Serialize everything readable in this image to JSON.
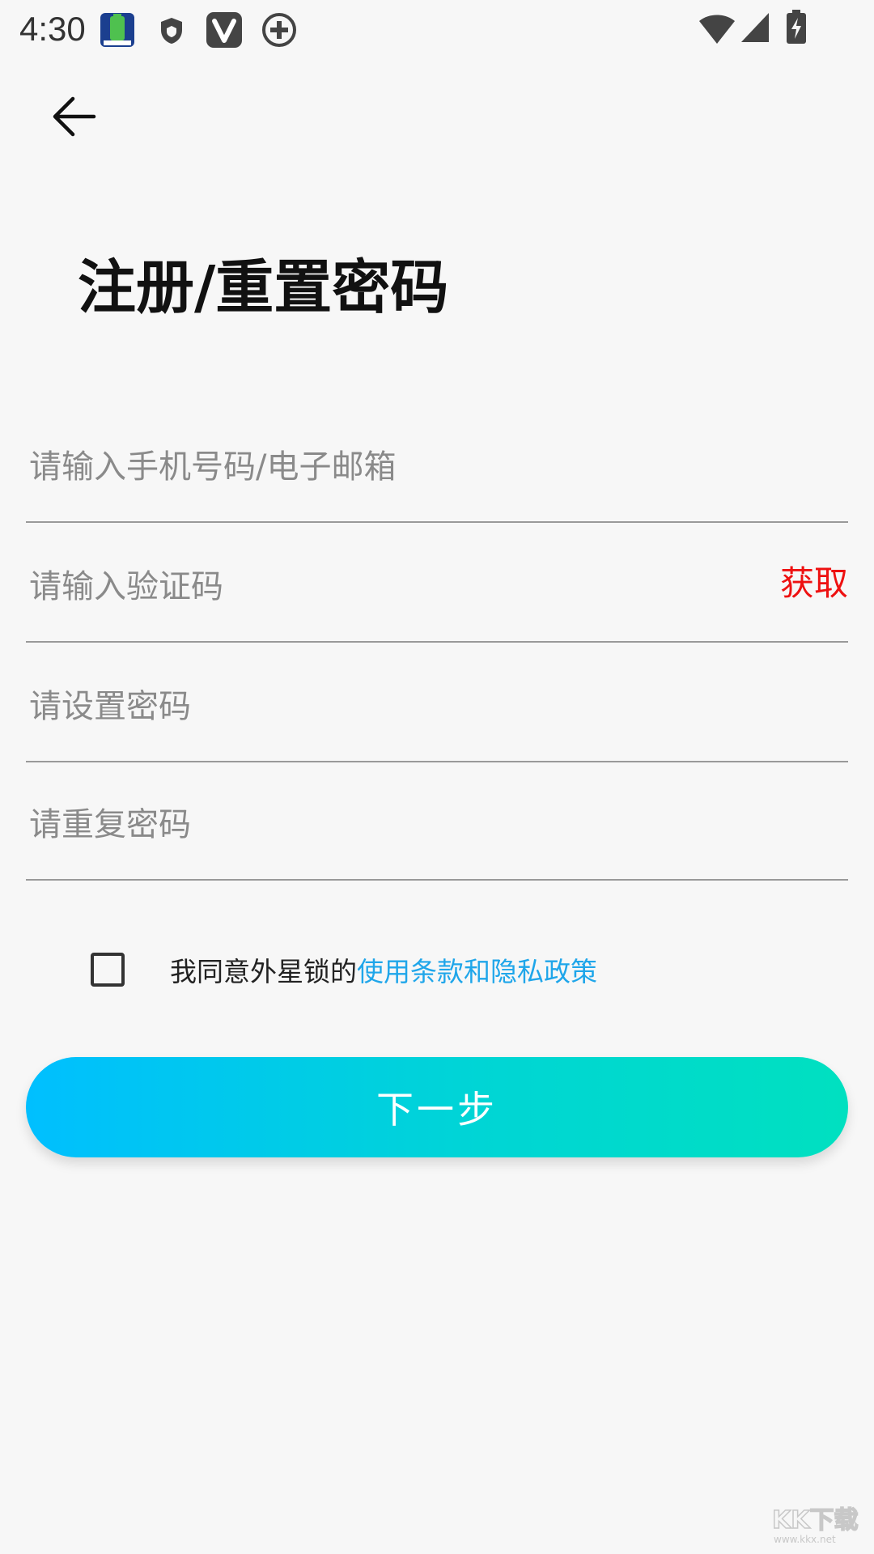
{
  "status_bar": {
    "time": "4:30"
  },
  "header": {
    "back_icon": "arrow-left-icon"
  },
  "title": "注册/重置密码",
  "form": {
    "account_placeholder": "请输入手机号码/电子邮箱",
    "code_placeholder": "请输入验证码",
    "get_code_label": "获取",
    "password_placeholder": "请设置密码",
    "repeat_placeholder": "请重复密码"
  },
  "agreement": {
    "text": "我同意外星锁的",
    "link": "使用条款和隐私政策"
  },
  "next_button": "下一步",
  "colors": {
    "accent_red": "#ee1111",
    "link_blue": "#1fa6ea",
    "gradient_start": "#00bfff",
    "gradient_end": "#00e0c0"
  },
  "watermark": "KK下载"
}
